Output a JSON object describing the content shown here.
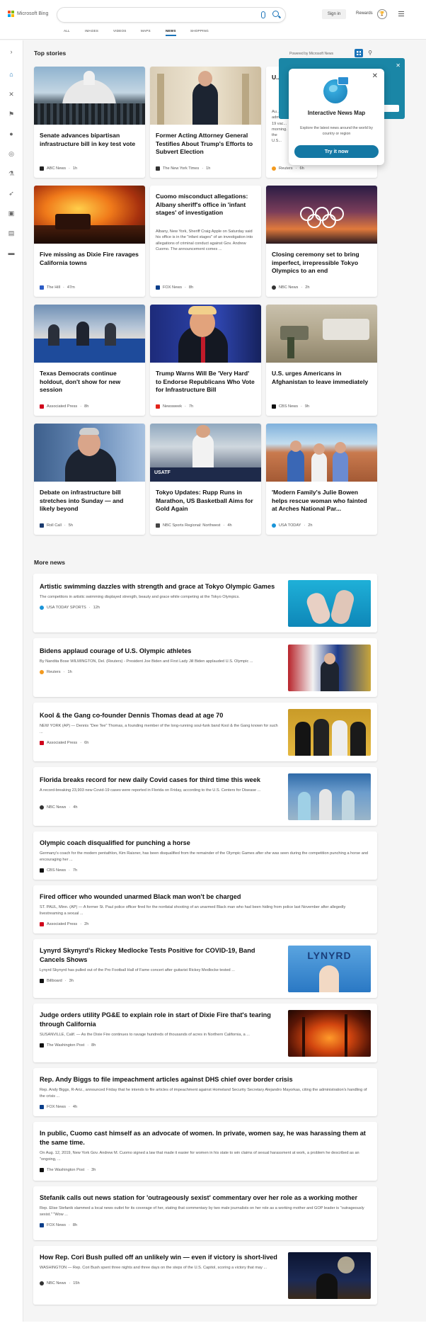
{
  "header": {
    "logo_text": "Microsoft Bing",
    "sign_in": "Sign in",
    "rewards": "Rewards",
    "tabs": [
      {
        "label": "ALL"
      },
      {
        "label": "IMAGES"
      },
      {
        "label": "VIDEOS"
      },
      {
        "label": "MAPS"
      },
      {
        "label": "NEWS"
      },
      {
        "label": "SHOPPING"
      }
    ],
    "active_tab": "NEWS"
  },
  "rail": {
    "icons": [
      "expand-icon",
      "home-icon",
      "sports-icon",
      "flag-icon",
      "location-icon",
      "globe-icon",
      "science-icon",
      "rocket-icon",
      "entertainment-icon",
      "business-icon",
      "money-icon"
    ]
  },
  "top_stories": {
    "title": "Top stories",
    "powered_by": "Powered by Microsoft News",
    "cards": [
      {
        "title": "Senate advances bipartisan infrastructure bill in key test vote",
        "snippet": "",
        "source": "ABC News",
        "age": "1h",
        "src_color": "#222"
      },
      {
        "title": "Former Acting Attorney General Testifies About Trump's Efforts to Subvert Election",
        "snippet": "",
        "source": "The New York Times",
        "age": "1h",
        "src_color": "#333"
      },
      {
        "title": "U...",
        "snippet": "Au... admin... 19 vac... morning... the U.S...",
        "source": "Reuters",
        "age": "6h",
        "src_color": "#f39a1e"
      },
      {
        "title": "Five missing as Dixie Fire ravages California towns",
        "snippet": "",
        "source": "The Hill",
        "age": "47m",
        "src_color": "#2c5cc5"
      },
      {
        "title": "Cuomo misconduct allegations: Albany sheriff's office in 'infant stages' of investigation",
        "snippet": "Albany, New York, Sheriff Craig Apple on Saturday said his office is in the \"infant stages\" of an investigation into allegations of criminal conduct against Gov. Andrew Cuomo. The announcement comes ...",
        "source": "FOX News",
        "age": "8h",
        "src_color": "#0a3e8a"
      },
      {
        "title": "Closing ceremony set to bring imperfect, irrepressible Tokyo Olympics to an end",
        "snippet": "",
        "source": "NBC News",
        "age": "2h",
        "src_color": "#333"
      },
      {
        "title": "Texas Democrats continue holdout, don't show for new session",
        "snippet": "",
        "source": "Associated Press",
        "age": "8h",
        "src_color": "#d0021b"
      },
      {
        "title": "Trump Warns Will Be 'Very Hard' to Endorse Republicans Who Vote for Infrastructure Bill",
        "snippet": "",
        "source": "Newsweek",
        "age": "7h",
        "src_color": "#e2231a"
      },
      {
        "title": "U.S. urges Americans in Afghanistan to leave immediately",
        "snippet": "",
        "source": "CBS News",
        "age": "9h",
        "src_color": "#111"
      },
      {
        "title": "Debate on infrastructure bill stretches into Sunday — and likely beyond",
        "snippet": "",
        "source": "Roll Call",
        "age": "5h",
        "src_color": "#1b3b6f"
      },
      {
        "title": "Tokyo Updates: Rupp Runs in Marathon, US Basketball Aims for Gold Again",
        "snippet": "",
        "source": "NBC Sports Regional: Northwest",
        "age": "4h",
        "src_color": "#444"
      },
      {
        "title": "'Modern Family's Julie Bowen helps rescue woman who fainted at Arches National Par...",
        "snippet": "",
        "source": "USA TODAY",
        "age": "2h",
        "src_color": "#1a94d8"
      }
    ]
  },
  "popup": {
    "title": "Interactive News Map",
    "description": "Explore the latest news around the world by country or region",
    "button": "Try it now"
  },
  "more_news": {
    "title": "More news",
    "items": [
      {
        "title": "Artistic swimming dazzles with strength and grace at Tokyo Olympic Games",
        "snippet": "The competitors in artistic swimming displayed strength, beauty and grace while competing at the Tokyo Olympics.",
        "source": "USA TODAY SPORTS",
        "age": "12h",
        "src_color": "#1a94d8"
      },
      {
        "title": "Bidens applaud courage of U.S. Olympic athletes",
        "snippet": "By Nandita Bose WILMINGTON, Del. (Reuters) - President Joe Biden and First Lady Jill Biden applauded U.S. Olympic ...",
        "source": "Reuters",
        "age": "1h",
        "src_color": "#f39a1e"
      },
      {
        "title": "Kool & the Gang co-founder Dennis Thomas dead at age 70",
        "snippet": "NEW YORK (AP) — Dennis \"Dee Tee\" Thomas, a founding member of the long-running soul-funk band Kool & the Gang known for such ...",
        "source": "Associated Press",
        "age": "6h",
        "src_color": "#d0021b"
      },
      {
        "title": "Florida breaks record for new daily Covid cases for third time this week",
        "snippet": "A record-breaking 23,903 new Covid-19 cases were reported in Florida on Friday, according to the U.S. Centers for Disease ...",
        "source": "NBC News",
        "age": "4h",
        "src_color": "#333"
      },
      {
        "title": "Olympic coach disqualified for punching a horse",
        "snippet": "Germany's coach for the modern pentathlon, Kim Raisner, has been disqualified from the remainder of the Olympic Games after she was seen during the competition punching a horse and encouraging her ...",
        "source": "CBS News",
        "age": "7h",
        "src_color": "#111"
      },
      {
        "title": "Fired officer who wounded unarmed Black man won't be charged",
        "snippet": "ST. PAUL, Minn. (AP) — A former St. Paul police officer fired for the nonfatal shooting of an unarmed Black man who had been hiding from police last November after allegedly livestreaming a sexual ...",
        "source": "Associated Press",
        "age": "2h",
        "src_color": "#d0021b"
      },
      {
        "title": "Lynyrd Skynyrd's Rickey Medlocke Tests Positive for COVID-19, Band Cancels Shows",
        "snippet": "Lynyrd Skynyrd has pulled out of the Pro Football Hall of Fame concert after guitarist Rickey Medlocke tested ...",
        "source": "Billboard",
        "age": "3h",
        "src_color": "#111"
      },
      {
        "title": "Judge orders utility PG&E to explain role in start of Dixie Fire that's tearing through California",
        "snippet": "SUSANVILLE, Calif. — As the Dixie Fire continues to ravage hundreds of thousands of acres in Northern California, a ...",
        "source": "The Washington Post",
        "age": "8h",
        "src_color": "#111"
      },
      {
        "title": "Rep. Andy Biggs to file impeachment articles against DHS chief over border crisis",
        "snippet": "Rep. Andy Biggs, R-Ariz., announced Friday that he intends to file articles of impeachment against Homeland Security Secretary Alejandro Mayorkas, citing the administration's handling of the crisis ...",
        "source": "FOX News",
        "age": "4h",
        "src_color": "#0a3e8a"
      },
      {
        "title": "In public, Cuomo cast himself as an advocate of women. In private, women say, he was harassing them at the same time.",
        "snippet": "On Aug. 12, 2019, New York Gov. Andrew M. Cuomo signed a law that made it easier for women in his state to win claims of sexual harassment at work, a problem he described as an \"ongoing, ...",
        "source": "The Washington Post",
        "age": "3h",
        "src_color": "#111"
      },
      {
        "title": "Stefanik calls out news station for 'outrageously sexist' commentary over her role as a working mother",
        "snippet": "Rep. Elise Stefanik slammed a local news outlet for its coverage of her, stating that commentary by two male journalists on her role as a working mother and GOP leader is \"outrageously sexist.\" \"Wow ...",
        "source": "FOX News",
        "age": "8h",
        "src_color": "#0a3e8a"
      },
      {
        "title": "How Rep. Cori Bush pulled off an unlikely win — even if victory is short-lived",
        "snippet": "WASHINGTON — Rep. Cori Bush spent three nights and three days on the steps of the U.S. Capitol, scoring a victory that may ...",
        "source": "NBC News",
        "age": "15h",
        "src_color": "#333"
      }
    ]
  },
  "footer": {
    "left": "",
    "right": ""
  }
}
